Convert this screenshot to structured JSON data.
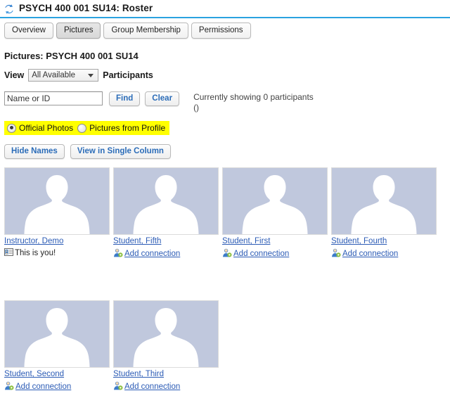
{
  "header": {
    "icon": "sync-icon",
    "title": "PSYCH 400 001 SU14: Roster",
    "rule_color": "#2aa2e0"
  },
  "tabs": [
    {
      "label": "Overview",
      "active": false
    },
    {
      "label": "Pictures",
      "active": true
    },
    {
      "label": "Group Membership",
      "active": false
    },
    {
      "label": "Permissions",
      "active": false
    }
  ],
  "main": {
    "section_title": "Pictures: PSYCH 400 001 SU14",
    "view_label": "View",
    "view_selected": "All Available",
    "view_options": [
      "All Available"
    ],
    "participants_label": "Participants",
    "search": {
      "value": "Name or ID",
      "placeholder": "Name or ID",
      "find_label": "Find",
      "clear_label": "Clear"
    },
    "status_line_1": "Currently showing 0 participants",
    "status_line_2": "()",
    "photo_source": {
      "highlight_color": "#ffff00",
      "options": [
        {
          "label": "Official Photos",
          "selected": true
        },
        {
          "label": "Pictures from Profile",
          "selected": false
        }
      ]
    },
    "actions": {
      "hide_names_label": "Hide Names",
      "single_column_label": "View in Single Column"
    },
    "avatar_bg_color": "#c0c8dd",
    "link_color": "#2b5bb5",
    "people": [
      {
        "name": "Instructor, Demo",
        "avatar": "person-silhouette",
        "action_label": "This is you!",
        "action_icon": "id-card-icon",
        "is_self": true
      },
      {
        "name": "Student, Fifth",
        "avatar": "person-silhouette",
        "action_label": "Add connection",
        "action_icon": "add-user-icon",
        "is_self": false
      },
      {
        "name": "Student, First",
        "avatar": "person-silhouette",
        "action_label": "Add connection",
        "action_icon": "add-user-icon",
        "is_self": false
      },
      {
        "name": "Student, Fourth",
        "avatar": "person-silhouette",
        "action_label": "Add connection",
        "action_icon": "add-user-icon",
        "is_self": false
      },
      {
        "name": "Student, Second",
        "avatar": "person-silhouette",
        "action_label": "Add connection",
        "action_icon": "add-user-icon",
        "is_self": false
      },
      {
        "name": "Student, Third",
        "avatar": "person-silhouette",
        "action_label": "Add connection",
        "action_icon": "add-user-icon",
        "is_self": false
      }
    ]
  }
}
